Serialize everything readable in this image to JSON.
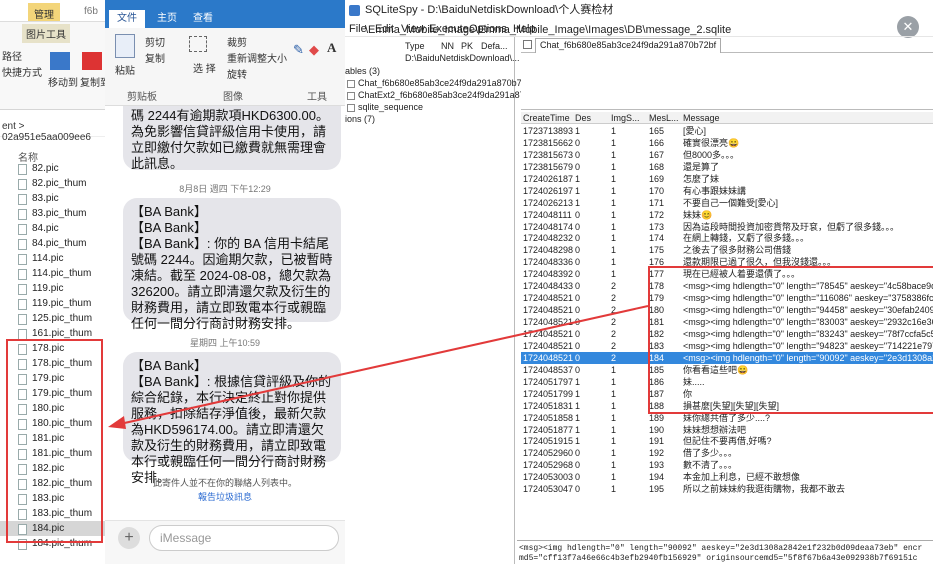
{
  "explorer": {
    "tab_mgmt": "管理",
    "tab_prefix": "f6b",
    "tab_pic_tool": "图片工具",
    "ribbon_items": [
      "路径",
      "快捷方式",
      "移动到",
      "复制到"
    ],
    "address": "ent  >  02a951e5aa009ee6",
    "col_name": "名称",
    "files": [
      "82.pic",
      "82.pic_thum",
      "83.pic",
      "83.pic_thum",
      "84.pic",
      "84.pic_thum",
      "114.pic",
      "114.pic_thum",
      "119.pic",
      "119.pic_thum",
      "125.pic_thum",
      "161.pic_thum",
      "178.pic",
      "178.pic_thum",
      "179.pic",
      "179.pic_thum",
      "180.pic",
      "180.pic_thum",
      "181.pic",
      "181.pic_thum",
      "182.pic",
      "182.pic_thum",
      "183.pic",
      "183.pic_thum",
      "184.pic",
      "184.pic_thum"
    ],
    "selected_index": 24
  },
  "messages": {
    "tabs": [
      "文件",
      "主页",
      "查看"
    ],
    "ribbon": {
      "paste": "粘贴",
      "cut": "剪切",
      "copy": "复制",
      "select": "选\n择",
      "crop": "裁剪",
      "resize": "重新调整大小",
      "rotate": "旋转",
      "clipboard": "剪贴板",
      "image": "图像",
      "tools": "工具"
    },
    "bubble1": "碼 2244有逾期款項HKD6300.00。為免影響信貸評級信用卡使用，請立即繳付欠款如已繳費就無需理會此訊息。",
    "ts1": "8月8日 週四 下午12:29",
    "bubble2": "【BA Bank】\n【BA Bank】\n【BA Bank】: 你的 BA 信用卡結尾號碼 2244。因逾期欠款，已被暫時凍結。截至 2024-08-08，總欠款為 326200。請立即清還欠款及衍生的財務費用，請立即致電本行或親臨任何一間分行商討財務安排。",
    "ts2": "星期四 上午10:59",
    "bubble3": "【BA Bank】\n【BA Bank】: 根據信貸評級及你的綜合紀錄，本行決定終止對你提供服務，扣除結存淨值後，最新欠款為HKD596174.00。請立即清還欠款及衍生的財務費用，請立即致電本行或親臨任何一間分行商討財務安排。",
    "footer_note": "此寄件人並不在你的聯絡人列表中。",
    "footer_link": "報告垃圾訊息",
    "input_placeholder": "iMessage"
  },
  "sqlite": {
    "title": "SQLiteSpy - D:\\BaiduNetdiskDownload\\个人赛检材\\Emma_Mobile_Image\\Emma_Mobile_Image\\Images\\DB\\message_2.sqlite",
    "menu": [
      "File",
      "Edit",
      "View",
      "Execute",
      "Options",
      "Help"
    ],
    "props_header": [
      "Type",
      "NN",
      "PK",
      "Defa..."
    ],
    "props_row": "D:\\BaiduNetdiskDownload\\...",
    "tree": [
      "ables (3)",
      "Chat_f6b680e85ab3ce24f9da291a870b72bf",
      "ChatExt2_f6b680e85ab3ce24f9da291a870...",
      "sqlite_sequence",
      "ions (7)"
    ],
    "query_tab": "Chat_f6b680e85ab3ce24f9da291a870b72bf",
    "columns": [
      "CreateTime",
      "Des",
      "ImgS...",
      "MesL...",
      "Message"
    ],
    "rows": [
      [
        "1723713893",
        "1",
        "1",
        "165",
        "[愛心]"
      ],
      [
        "1723815662",
        "0",
        "1",
        "166",
        "確實很漂亮😀"
      ],
      [
        "1723815673",
        "0",
        "1",
        "167",
        "但8000多。。。"
      ],
      [
        "1723815679",
        "0",
        "1",
        "168",
        "還是算了"
      ],
      [
        "1724026187",
        "1",
        "1",
        "169",
        "怎麼了妹"
      ],
      [
        "1724026197",
        "1",
        "1",
        "170",
        "有心事跟妹妹講"
      ],
      [
        "1724026213",
        "1",
        "1",
        "171",
        "不要自己一個難受[愛心]"
      ],
      [
        "1724048111",
        "0",
        "1",
        "172",
        "妹妹😊"
      ],
      [
        "1724048174",
        "0",
        "1",
        "173",
        "因為這段時間投資加密貨幣及玗袞，但虧了很多錢。。。"
      ],
      [
        "1724048232",
        "0",
        "1",
        "174",
        "在網上轉錢，又虧了很多錢。。。"
      ],
      [
        "1724048298",
        "0",
        "1",
        "175",
        "之後去了很多財務公司借錢"
      ],
      [
        "1724048336",
        "0",
        "1",
        "176",
        "還款期限已過了很久，但我沒錢還。。。"
      ],
      [
        "1724048392",
        "0",
        "1",
        "177",
        "現在已經被人着要還債了。。。"
      ],
      [
        "1724048433",
        "0",
        "2",
        "178",
        "<msg><img hdlength=\"0\" length=\"78545\" aeskey=\"4c58bace9d6d4..."
      ],
      [
        "1724048521",
        "0",
        "2",
        "179",
        "<msg><img hdlength=\"0\" length=\"116086\" aeskey=\"3758386fc679..."
      ],
      [
        "1724048521",
        "0",
        "2",
        "180",
        "<msg><img hdlength=\"0\" length=\"94458\" aeskey=\"30efab2409873..."
      ],
      [
        "1724048521",
        "0",
        "2",
        "181",
        "<msg><img hdlength=\"0\" length=\"83003\" aeskey=\"2932c16e3627a..."
      ],
      [
        "1724048521",
        "0",
        "2",
        "182",
        "<msg><img hdlength=\"0\" length=\"83243\" aeskey=\"78f7ccfa5c5329..."
      ],
      [
        "1724048521",
        "0",
        "2",
        "183",
        "<msg><img hdlength=\"0\" length=\"94823\" aeskey=\"714221e7977c2..."
      ],
      [
        "1724048521",
        "0",
        "2",
        "184",
        "<msg><img hdlength=\"0\" length=\"90092\" aeskey=\"2e3d1308a2842..."
      ],
      [
        "1724048537",
        "0",
        "1",
        "185",
        "你看看這些吧😀"
      ],
      [
        "1724051797",
        "1",
        "1",
        "186",
        "妹....."
      ],
      [
        "1724051799",
        "1",
        "1",
        "187",
        "你"
      ],
      [
        "1724051831",
        "1",
        "1",
        "188",
        "損甚麼[失望][失望][失望]"
      ],
      [
        "1724051858",
        "1",
        "1",
        "189",
        "妹你總共借了多少....?"
      ],
      [
        "1724051877",
        "1",
        "1",
        "190",
        "妹妹想想辦法吧"
      ],
      [
        "1724051915",
        "1",
        "1",
        "191",
        "但記住不要再借,好嗎?"
      ],
      [
        "1724052960",
        "0",
        "1",
        "192",
        "借了多少。。。"
      ],
      [
        "1724052968",
        "0",
        "1",
        "193",
        "數不清了。。。"
      ],
      [
        "1724053003",
        "0",
        "1",
        "194",
        "本金加上利息，已經不敢想像"
      ],
      [
        "1724053047",
        "0",
        "1",
        "195",
        "所以之前妹妹約我逛街購物，我都不敢去"
      ]
    ],
    "selected_row": 19,
    "bottom_text_1": "<msg><img hdlength=\"0\" length=\"90092\" aeskey=\"2e3d1308a2842e1f232b0d09deaa73eb\" encr",
    "bottom_text_2": "md5=\"cff13f7a46e66c4b3efb2940fb156929\" originsourcemd5=\"5f8f67b6a43e092938b7f69151c"
  },
  "colors": {
    "red_highlight": "#e23a3a",
    "word_blue": "#2b79c9",
    "select_blue": "#3388dd"
  }
}
